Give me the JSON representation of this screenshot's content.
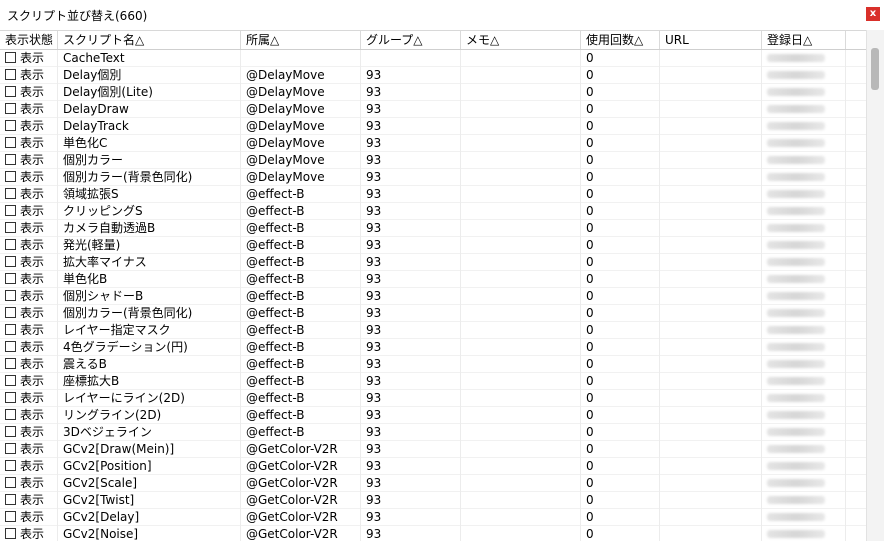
{
  "window": {
    "title": "スクリプト並び替え(660)",
    "close_label": "x"
  },
  "columns": {
    "state": "表示状態",
    "name": "スクリプト名△",
    "owner": "所属△",
    "group": "グループ△",
    "memo": "メモ△",
    "usage": "使用回数△",
    "url": "URL",
    "date": "登録日△"
  },
  "rows": [
    {
      "state": "表示",
      "name": "CacheText",
      "owner": "",
      "group": "",
      "memo": "",
      "usage": "0",
      "url": ""
    },
    {
      "state": "表示",
      "name": "Delay個別",
      "owner": "@DelayMove",
      "group": "93",
      "memo": "",
      "usage": "0",
      "url": ""
    },
    {
      "state": "表示",
      "name": "Delay個別(Lite)",
      "owner": "@DelayMove",
      "group": "93",
      "memo": "",
      "usage": "0",
      "url": ""
    },
    {
      "state": "表示",
      "name": "DelayDraw",
      "owner": "@DelayMove",
      "group": "93",
      "memo": "",
      "usage": "0",
      "url": ""
    },
    {
      "state": "表示",
      "name": "DelayTrack",
      "owner": "@DelayMove",
      "group": "93",
      "memo": "",
      "usage": "0",
      "url": ""
    },
    {
      "state": "表示",
      "name": "単色化C",
      "owner": "@DelayMove",
      "group": "93",
      "memo": "",
      "usage": "0",
      "url": ""
    },
    {
      "state": "表示",
      "name": "個別カラー",
      "owner": "@DelayMove",
      "group": "93",
      "memo": "",
      "usage": "0",
      "url": ""
    },
    {
      "state": "表示",
      "name": "個別カラー(背景色同化)",
      "owner": "@DelayMove",
      "group": "93",
      "memo": "",
      "usage": "0",
      "url": ""
    },
    {
      "state": "表示",
      "name": "領域拡張S",
      "owner": "@effect-B",
      "group": "93",
      "memo": "",
      "usage": "0",
      "url": ""
    },
    {
      "state": "表示",
      "name": "クリッピングS",
      "owner": "@effect-B",
      "group": "93",
      "memo": "",
      "usage": "0",
      "url": ""
    },
    {
      "state": "表示",
      "name": "カメラ自動透過B",
      "owner": "@effect-B",
      "group": "93",
      "memo": "",
      "usage": "0",
      "url": ""
    },
    {
      "state": "表示",
      "name": "発光(軽量)",
      "owner": "@effect-B",
      "group": "93",
      "memo": "",
      "usage": "0",
      "url": ""
    },
    {
      "state": "表示",
      "name": "拡大率マイナス",
      "owner": "@effect-B",
      "group": "93",
      "memo": "",
      "usage": "0",
      "url": ""
    },
    {
      "state": "表示",
      "name": "単色化B",
      "owner": "@effect-B",
      "group": "93",
      "memo": "",
      "usage": "0",
      "url": ""
    },
    {
      "state": "表示",
      "name": "個別シャドーB",
      "owner": "@effect-B",
      "group": "93",
      "memo": "",
      "usage": "0",
      "url": ""
    },
    {
      "state": "表示",
      "name": "個別カラー(背景色同化)",
      "owner": "@effect-B",
      "group": "93",
      "memo": "",
      "usage": "0",
      "url": ""
    },
    {
      "state": "表示",
      "name": "レイヤー指定マスク",
      "owner": "@effect-B",
      "group": "93",
      "memo": "",
      "usage": "0",
      "url": ""
    },
    {
      "state": "表示",
      "name": "4色グラデーション(円)",
      "owner": "@effect-B",
      "group": "93",
      "memo": "",
      "usage": "0",
      "url": ""
    },
    {
      "state": "表示",
      "name": "震えるB",
      "owner": "@effect-B",
      "group": "93",
      "memo": "",
      "usage": "0",
      "url": ""
    },
    {
      "state": "表示",
      "name": "座標拡大B",
      "owner": "@effect-B",
      "group": "93",
      "memo": "",
      "usage": "0",
      "url": ""
    },
    {
      "state": "表示",
      "name": "レイヤーにライン(2D)",
      "owner": "@effect-B",
      "group": "93",
      "memo": "",
      "usage": "0",
      "url": ""
    },
    {
      "state": "表示",
      "name": "リングライン(2D)",
      "owner": "@effect-B",
      "group": "93",
      "memo": "",
      "usage": "0",
      "url": ""
    },
    {
      "state": "表示",
      "name": "3Dベジェライン",
      "owner": "@effect-B",
      "group": "93",
      "memo": "",
      "usage": "0",
      "url": ""
    },
    {
      "state": "表示",
      "name": "GCv2[Draw(Mein)]",
      "owner": "@GetColor-V2R",
      "group": "93",
      "memo": "",
      "usage": "0",
      "url": ""
    },
    {
      "state": "表示",
      "name": "GCv2[Position]",
      "owner": "@GetColor-V2R",
      "group": "93",
      "memo": "",
      "usage": "0",
      "url": ""
    },
    {
      "state": "表示",
      "name": "GCv2[Scale]",
      "owner": "@GetColor-V2R",
      "group": "93",
      "memo": "",
      "usage": "0",
      "url": ""
    },
    {
      "state": "表示",
      "name": "GCv2[Twist]",
      "owner": "@GetColor-V2R",
      "group": "93",
      "memo": "",
      "usage": "0",
      "url": ""
    },
    {
      "state": "表示",
      "name": "GCv2[Delay]",
      "owner": "@GetColor-V2R",
      "group": "93",
      "memo": "",
      "usage": "0",
      "url": ""
    },
    {
      "state": "表示",
      "name": "GCv2[Noise]",
      "owner": "@GetColor-V2R",
      "group": "93",
      "memo": "",
      "usage": "0",
      "url": ""
    }
  ]
}
